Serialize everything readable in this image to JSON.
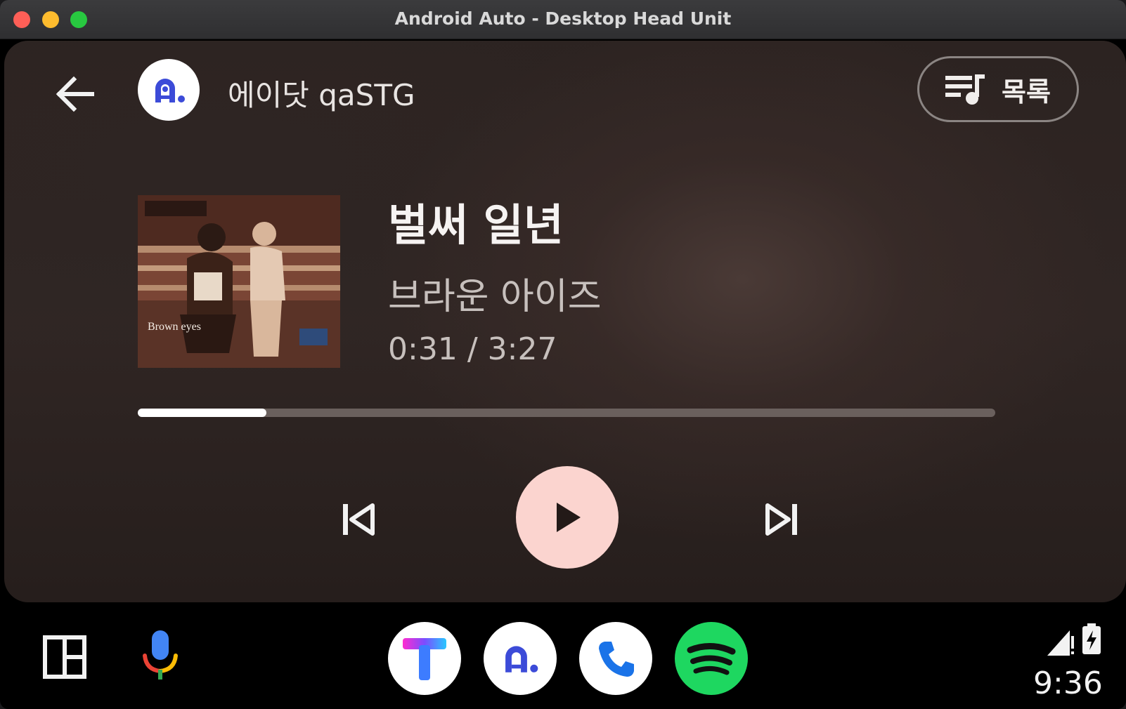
{
  "window": {
    "title": "Android Auto - Desktop Head Unit"
  },
  "header": {
    "app_name": "에이닷 qaSTG",
    "list_button_label": "목록"
  },
  "now_playing": {
    "title": "벌써 일년",
    "artist": "브라운 아이즈",
    "elapsed": "0:31",
    "separator": "/",
    "duration": "3:27",
    "progress_fraction": 0.15,
    "album_art_text": "Brown eyes"
  },
  "controls": {
    "previous": "skip-previous-icon",
    "play": "play-icon",
    "next": "skip-next-icon"
  },
  "dock": {
    "apps": [
      "T map",
      "A. (에이닷)",
      "Phone",
      "Spotify"
    ]
  },
  "status": {
    "clock": "9:36"
  },
  "colors": {
    "play_button": "#fbd4cf",
    "spotify": "#1ed760",
    "accent_blue": "#3c4bd8"
  }
}
